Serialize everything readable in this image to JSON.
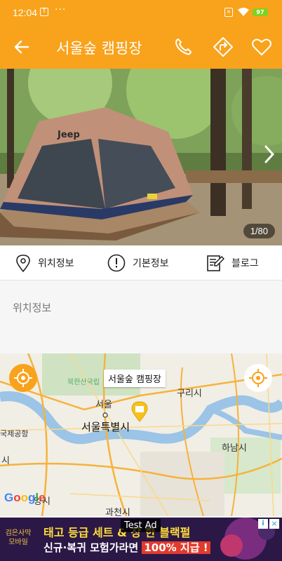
{
  "status_bar": {
    "time": "12:04",
    "battery": "97",
    "more_indicator": "···"
  },
  "app_bar": {
    "title": "서울숲 캠핑장"
  },
  "photo": {
    "counter": "1/80",
    "tent_brand": "Jeep"
  },
  "tabs": [
    {
      "label": "위치정보",
      "icon": "location-pin-icon"
    },
    {
      "label": "기본정보",
      "icon": "info-icon"
    },
    {
      "label": "블로그",
      "icon": "blog-edit-icon"
    }
  ],
  "section": {
    "label": "위치정보"
  },
  "map": {
    "pin_label": "서울숲 캠핑장",
    "places": {
      "bukhansan": "북한산국립",
      "guri": "구리시",
      "seoul": "서울",
      "seoul_city": "서울특별시",
      "airport": "국제공항",
      "hanam": "하남시",
      "si_left": "시",
      "si_bottom": "양시",
      "gwacheon": "과천시"
    },
    "google_logo": "Google"
  },
  "ad": {
    "badge": "Test Ad",
    "brand_line1": "검은사막",
    "brand_line2": "모바일",
    "headline": "태고 등급 세트 & 장 한 블랙펄",
    "subline": "신규·복귀 모험가라면",
    "highlight": "100% 지급 !"
  },
  "colors": {
    "primary": "#f9a21b",
    "water": "#9bc4e6",
    "road": "#f6b23a"
  }
}
